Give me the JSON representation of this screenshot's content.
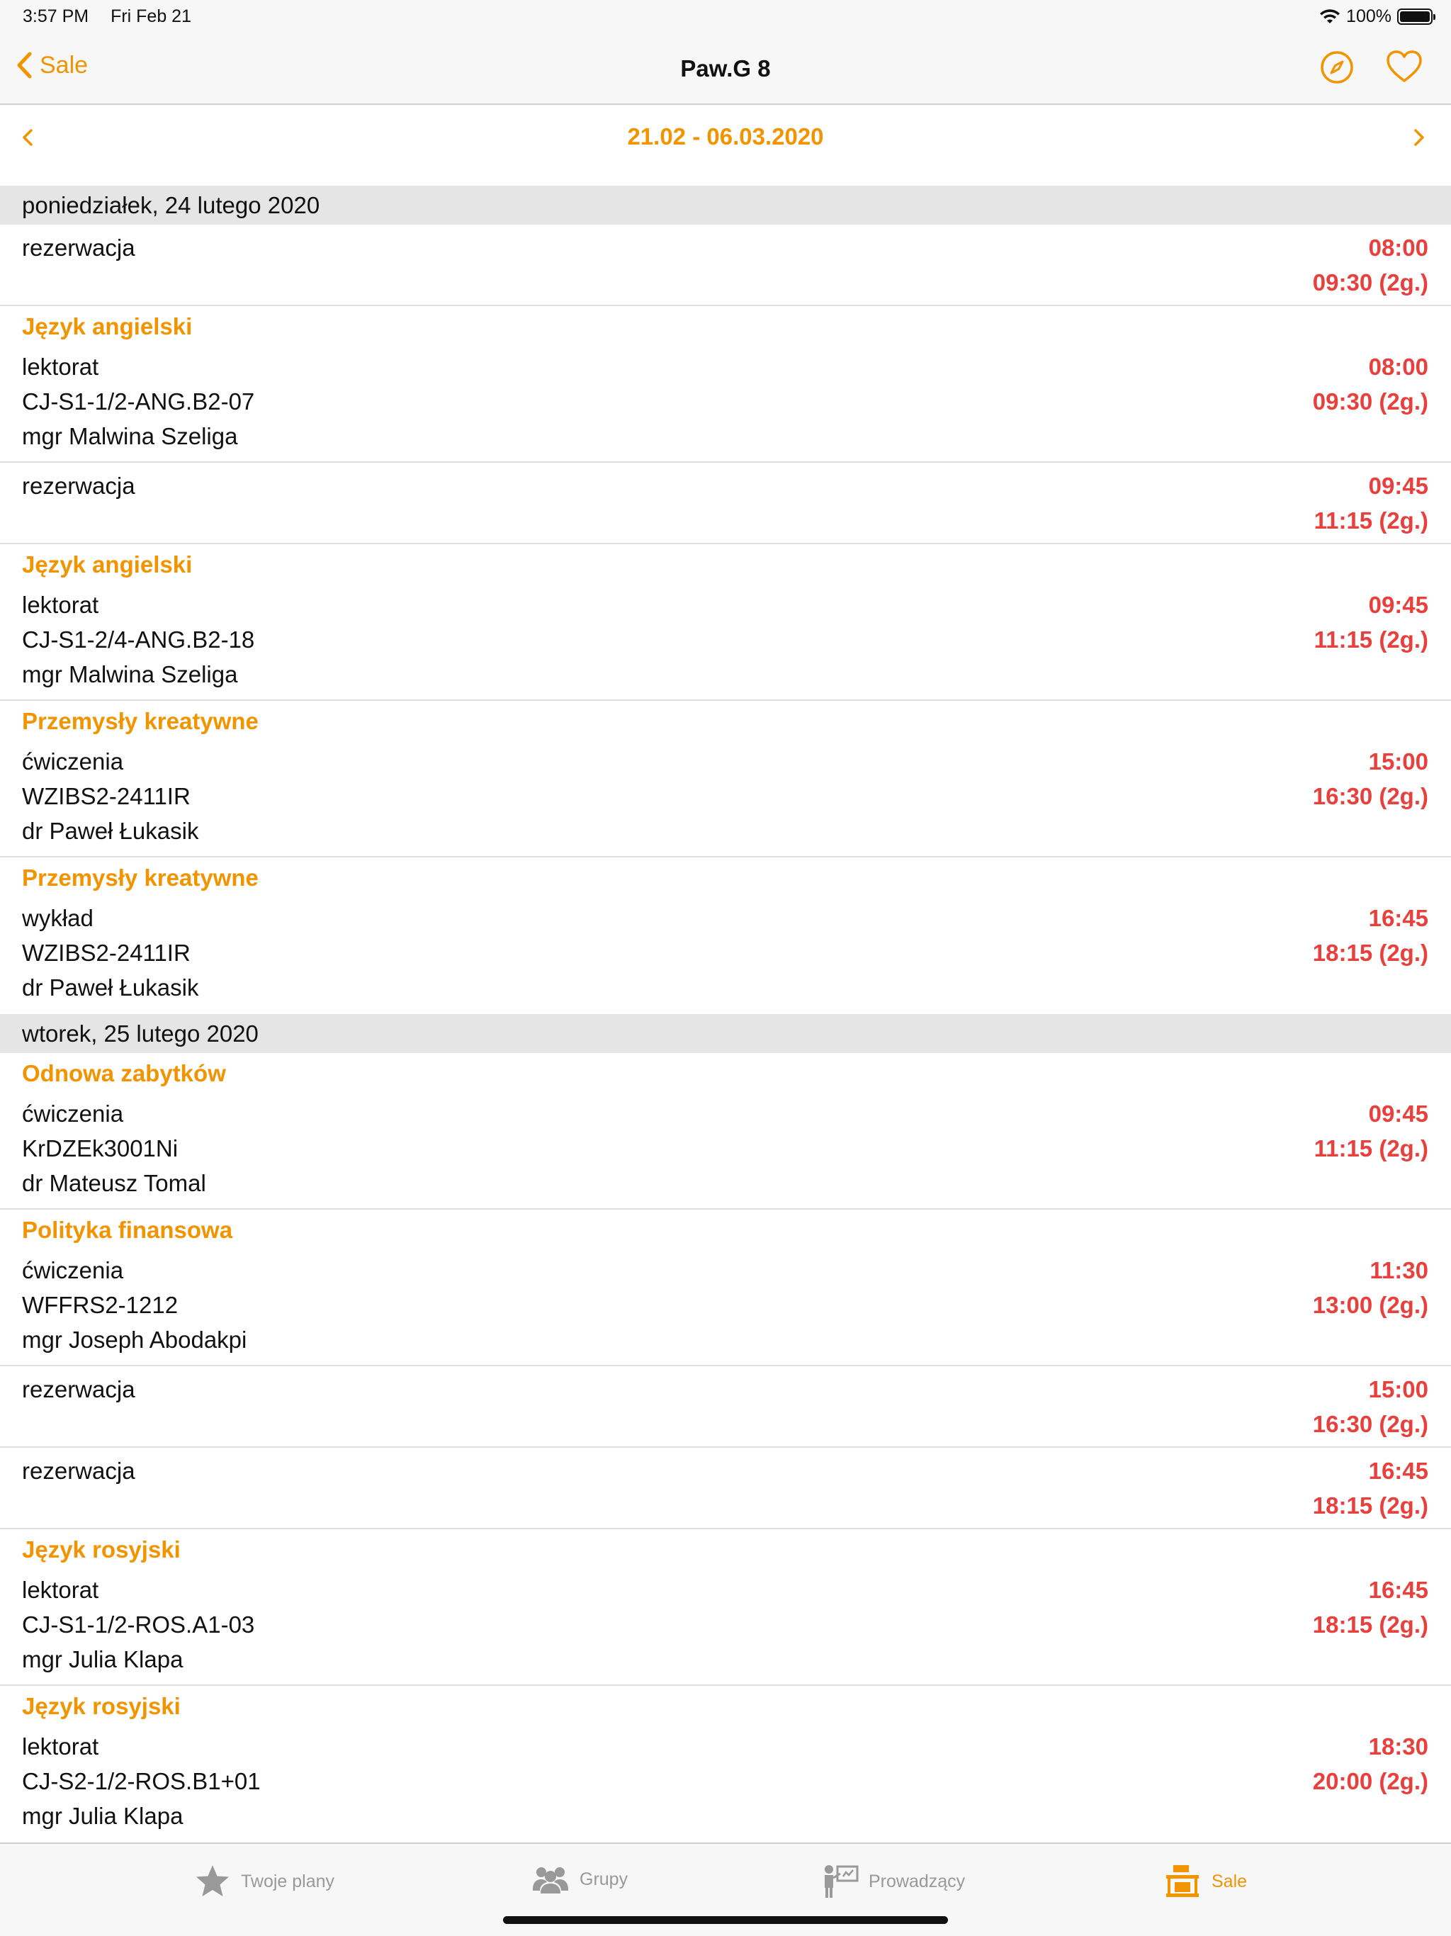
{
  "status": {
    "time": "3:57 PM",
    "date": "Fri Feb 21",
    "battery": "100%"
  },
  "nav": {
    "back_label": "Sale",
    "title": "Paw.G  8"
  },
  "range": "21.02 - 06.03.2020",
  "days": [
    {
      "header": "poniedziałek, 24 lutego 2020"
    },
    {
      "header": "wtorek, 25 lutego 2020"
    }
  ],
  "entries": [
    {
      "type": "rezerwacja",
      "start": "08:00",
      "end": "09:30 (2g.)"
    },
    {
      "subject": "Język angielski",
      "type": "lektorat",
      "group": "CJ-S1-1/2-ANG.B2-07",
      "teacher": "mgr Malwina Szeliga",
      "start": "08:00",
      "end": "09:30 (2g.)"
    },
    {
      "type": "rezerwacja",
      "start": "09:45",
      "end": "11:15 (2g.)"
    },
    {
      "subject": "Język angielski",
      "type": "lektorat",
      "group": "CJ-S1-2/4-ANG.B2-18",
      "teacher": "mgr Malwina Szeliga",
      "start": "09:45",
      "end": "11:15 (2g.)"
    },
    {
      "subject": "Przemysły kreatywne",
      "type": "ćwiczenia",
      "group": "WZIBS2-2411IR",
      "teacher": "dr Paweł Łukasik",
      "start": "15:00",
      "end": "16:30 (2g.)"
    },
    {
      "subject": "Przemysły kreatywne",
      "type": "wykład",
      "group": "WZIBS2-2411IR",
      "teacher": "dr Paweł Łukasik",
      "start": "16:45",
      "end": "18:15 (2g.)"
    },
    {
      "subject": "Odnowa zabytków",
      "type": "ćwiczenia",
      "group": "KrDZEk3001Ni",
      "teacher": "dr Mateusz Tomal",
      "start": "09:45",
      "end": "11:15 (2g.)"
    },
    {
      "subject": "Polityka finansowa",
      "type": "ćwiczenia",
      "group": "WFFRS2-1212",
      "teacher": "mgr Joseph Abodakpi",
      "start": "11:30",
      "end": "13:00 (2g.)"
    },
    {
      "type": "rezerwacja",
      "start": "15:00",
      "end": "16:30 (2g.)"
    },
    {
      "type": "rezerwacja",
      "start": "16:45",
      "end": "18:15 (2g.)"
    },
    {
      "subject": "Język rosyjski",
      "type": "lektorat",
      "group": "CJ-S1-1/2-ROS.A1-03",
      "teacher": "mgr Julia Klapa",
      "start": "16:45",
      "end": "18:15 (2g.)"
    },
    {
      "subject": "Język rosyjski",
      "type": "lektorat",
      "group": "CJ-S2-1/2-ROS.B1+01",
      "teacher": "mgr Julia Klapa",
      "start": "18:30",
      "end": "20:00 (2g.)"
    }
  ],
  "tabs": [
    {
      "label": "Twoje plany",
      "icon": "star-icon"
    },
    {
      "label": "Grupy",
      "icon": "people-icon"
    },
    {
      "label": "Prowadzący",
      "icon": "teacher-icon"
    },
    {
      "label": "Sale",
      "icon": "room-icon"
    }
  ],
  "colors": {
    "accent": "#f29400",
    "time": "#e8403c",
    "header_bg": "#e5e5e5"
  }
}
